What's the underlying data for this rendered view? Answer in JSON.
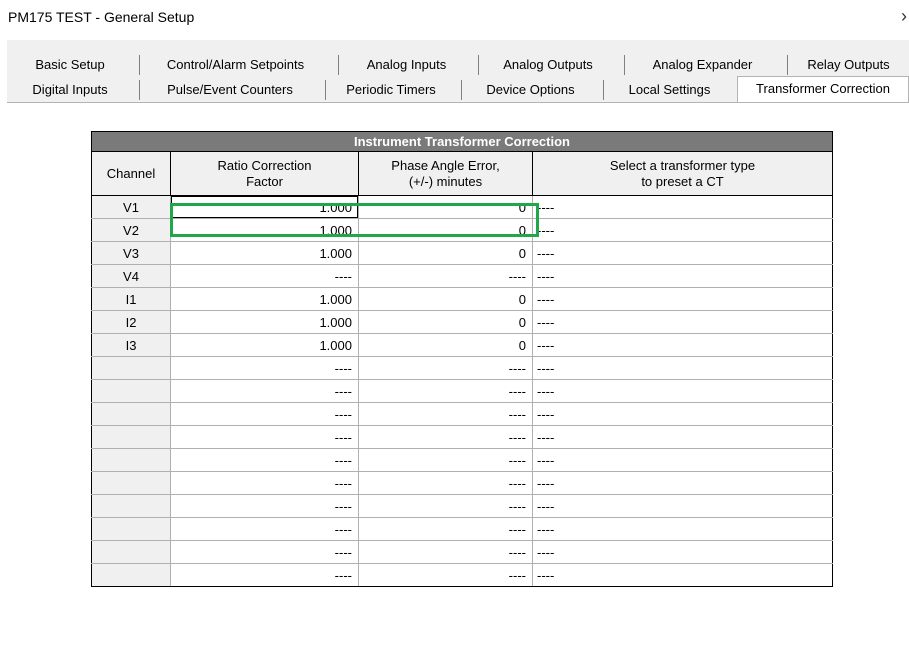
{
  "window": {
    "title": "PM175 TEST - General Setup",
    "close_glyph": "›"
  },
  "tabs": {
    "row1": [
      {
        "label": "Basic Setup"
      },
      {
        "label": "Control/Alarm Setpoints"
      },
      {
        "label": "Analog Inputs"
      },
      {
        "label": "Analog Outputs"
      },
      {
        "label": "Analog Expander"
      },
      {
        "label": "Relay Outputs"
      }
    ],
    "row2": [
      {
        "label": "Digital Inputs"
      },
      {
        "label": "Pulse/Event Counters"
      },
      {
        "label": "Periodic Timers"
      },
      {
        "label": "Device Options"
      },
      {
        "label": "Local Settings"
      },
      {
        "label": "Transformer Correction"
      }
    ],
    "active": "Transformer Correction"
  },
  "table": {
    "caption": "Instrument Transformer Correction",
    "headers": {
      "channel": "Channel",
      "ratio_1": "Ratio Correction",
      "ratio_2": "Factor",
      "phase_1": "Phase Angle Error,",
      "phase_2": "(+/-) minutes",
      "type_1": "Select a transformer type",
      "type_2": "to preset a CT"
    },
    "rows": [
      {
        "channel": "V1",
        "ratio": "1.000",
        "phase": "0",
        "type": "----"
      },
      {
        "channel": "V2",
        "ratio": "1.000",
        "phase": "0",
        "type": "----"
      },
      {
        "channel": "V3",
        "ratio": "1.000",
        "phase": "0",
        "type": "----"
      },
      {
        "channel": "V4",
        "ratio": "----",
        "phase": "----",
        "type": "----"
      },
      {
        "channel": "I1",
        "ratio": "1.000",
        "phase": "0",
        "type": "----"
      },
      {
        "channel": "I2",
        "ratio": "1.000",
        "phase": "0",
        "type": "----"
      },
      {
        "channel": "I3",
        "ratio": "1.000",
        "phase": "0",
        "type": "----"
      },
      {
        "channel": "",
        "ratio": "----",
        "phase": "----",
        "type": "----"
      },
      {
        "channel": "",
        "ratio": "----",
        "phase": "----",
        "type": "----"
      },
      {
        "channel": "",
        "ratio": "----",
        "phase": "----",
        "type": "----"
      },
      {
        "channel": "",
        "ratio": "----",
        "phase": "----",
        "type": "----"
      },
      {
        "channel": "",
        "ratio": "----",
        "phase": "----",
        "type": "----"
      },
      {
        "channel": "",
        "ratio": "----",
        "phase": "----",
        "type": "----"
      },
      {
        "channel": "",
        "ratio": "----",
        "phase": "----",
        "type": "----"
      },
      {
        "channel": "",
        "ratio": "----",
        "phase": "----",
        "type": "----"
      },
      {
        "channel": "",
        "ratio": "----",
        "phase": "----",
        "type": "----"
      },
      {
        "channel": "",
        "ratio": "----",
        "phase": "----",
        "type": "----"
      }
    ]
  },
  "colors": {
    "highlight": "#1fa84a",
    "caption_bg": "#7a7a7a",
    "dialog_bg": "#f0f0f0"
  }
}
